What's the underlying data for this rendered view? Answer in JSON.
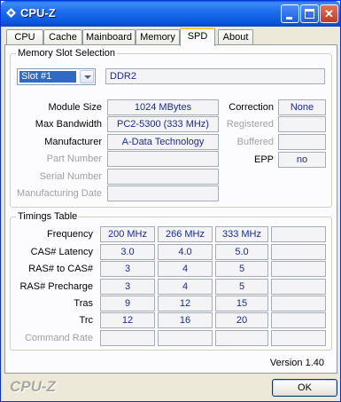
{
  "window": {
    "title": "CPU-Z"
  },
  "tabs": [
    "CPU",
    "Cache",
    "Mainboard",
    "Memory",
    "SPD",
    "About"
  ],
  "active_tab": "SPD",
  "slot_selection": {
    "legend": "Memory Slot Selection",
    "selected": "Slot #1",
    "type": "DDR2"
  },
  "module": {
    "module_size_label": "Module Size",
    "module_size": "1024 MBytes",
    "max_bandwidth_label": "Max Bandwidth",
    "max_bandwidth": "PC2-5300 (333 MHz)",
    "manufacturer_label": "Manufacturer",
    "manufacturer": "A-Data Technology",
    "part_number_label": "Part Number",
    "part_number": "",
    "serial_number_label": "Serial Number",
    "serial_number": "",
    "manufacturing_date_label": "Manufacturing Date",
    "manufacturing_date": "",
    "correction_label": "Correction",
    "correction": "None",
    "registered_label": "Registered",
    "registered": "",
    "buffered_label": "Buffered",
    "buffered": "",
    "epp_label": "EPP",
    "epp": "no"
  },
  "timings": {
    "legend": "Timings Table",
    "row_labels": [
      "Frequency",
      "CAS# Latency",
      "RAS# to CAS#",
      "RAS# Precharge",
      "Tras",
      "Trc",
      "Command Rate"
    ],
    "columns": [
      [
        "200 MHz",
        "3.0",
        "3",
        "3",
        "9",
        "12",
        ""
      ],
      [
        "266 MHz",
        "4.0",
        "4",
        "4",
        "12",
        "16",
        ""
      ],
      [
        "333 MHz",
        "5.0",
        "5",
        "5",
        "15",
        "20",
        ""
      ],
      [
        "",
        "",
        "",
        "",
        "",
        "",
        ""
      ]
    ]
  },
  "version": "Version 1.40",
  "brand": "CPU-Z",
  "ok_label": "OK"
}
